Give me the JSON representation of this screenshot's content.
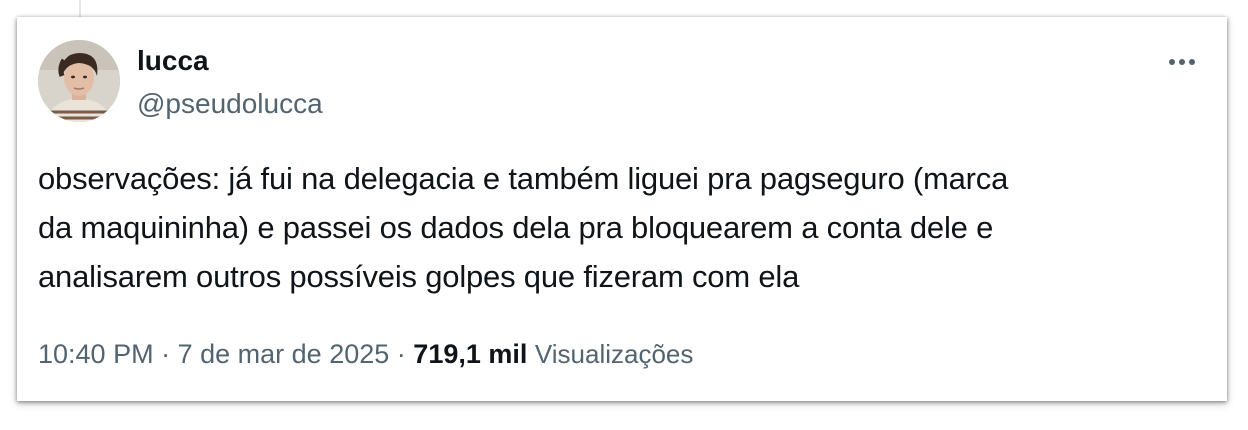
{
  "tweet": {
    "author": {
      "name": "lucca",
      "handle": "@pseudolucca"
    },
    "text_lines": [
      "observações: já fui na delegacia e também liguei pra pagseguro (marca",
      "da maquininha) e passei os dados dela pra bloquearem a conta dele e",
      "analisarem outros possíveis golpes que fizeram com ela"
    ],
    "meta": {
      "time": "10:40 PM",
      "separator": "·",
      "date": "7 de mar de 2025",
      "views_count": "719,1 mil",
      "views_label": "Visualizações"
    },
    "icons": {
      "more": "more-options-icon"
    }
  },
  "colors": {
    "text_primary": "#0f1419",
    "text_secondary": "#536471"
  }
}
